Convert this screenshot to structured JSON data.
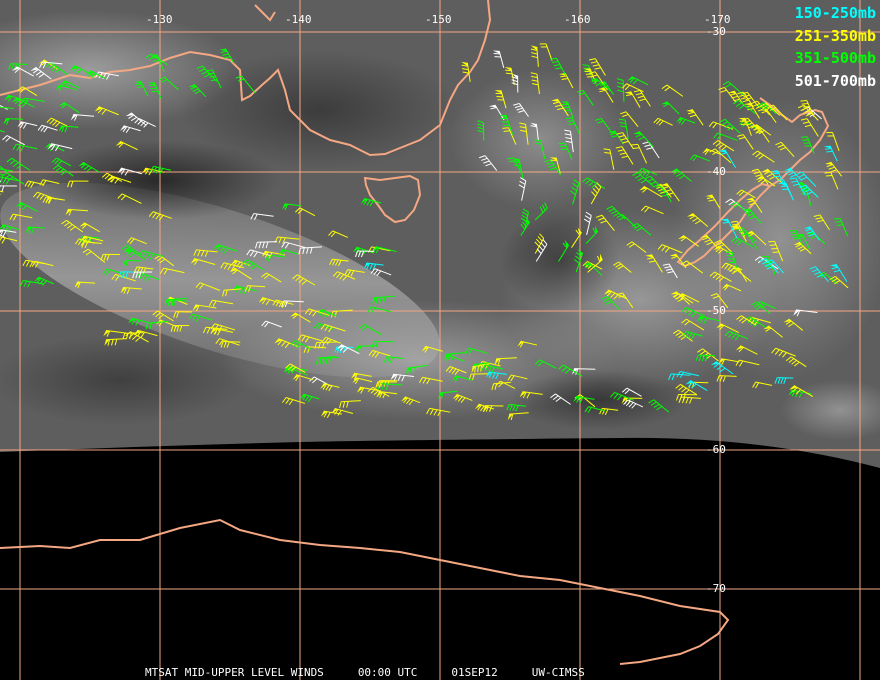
{
  "legend": [
    {
      "label": "150-250mb",
      "color": "#00ffff"
    },
    {
      "label": "251-350mb",
      "color": "#ffff00"
    },
    {
      "label": "351-500mb",
      "color": "#00ff00"
    },
    {
      "label": "501-700mb",
      "color": "#ffffff"
    }
  ],
  "longitude_labels": [
    "-130",
    "-140",
    "-150",
    "-160",
    "-170"
  ],
  "latitude_labels": [
    "-30",
    "-40",
    "-50",
    "-60",
    "-70"
  ],
  "footer": {
    "product": "MTSAT MID-UPPER LEVEL WINDS",
    "time": "00:00 UTC",
    "date": "01SEP12",
    "source": "UW-CIMSS"
  },
  "colors": {
    "gridline": "#f4a783",
    "coastline": "#f4a783",
    "background": "#000000"
  }
}
